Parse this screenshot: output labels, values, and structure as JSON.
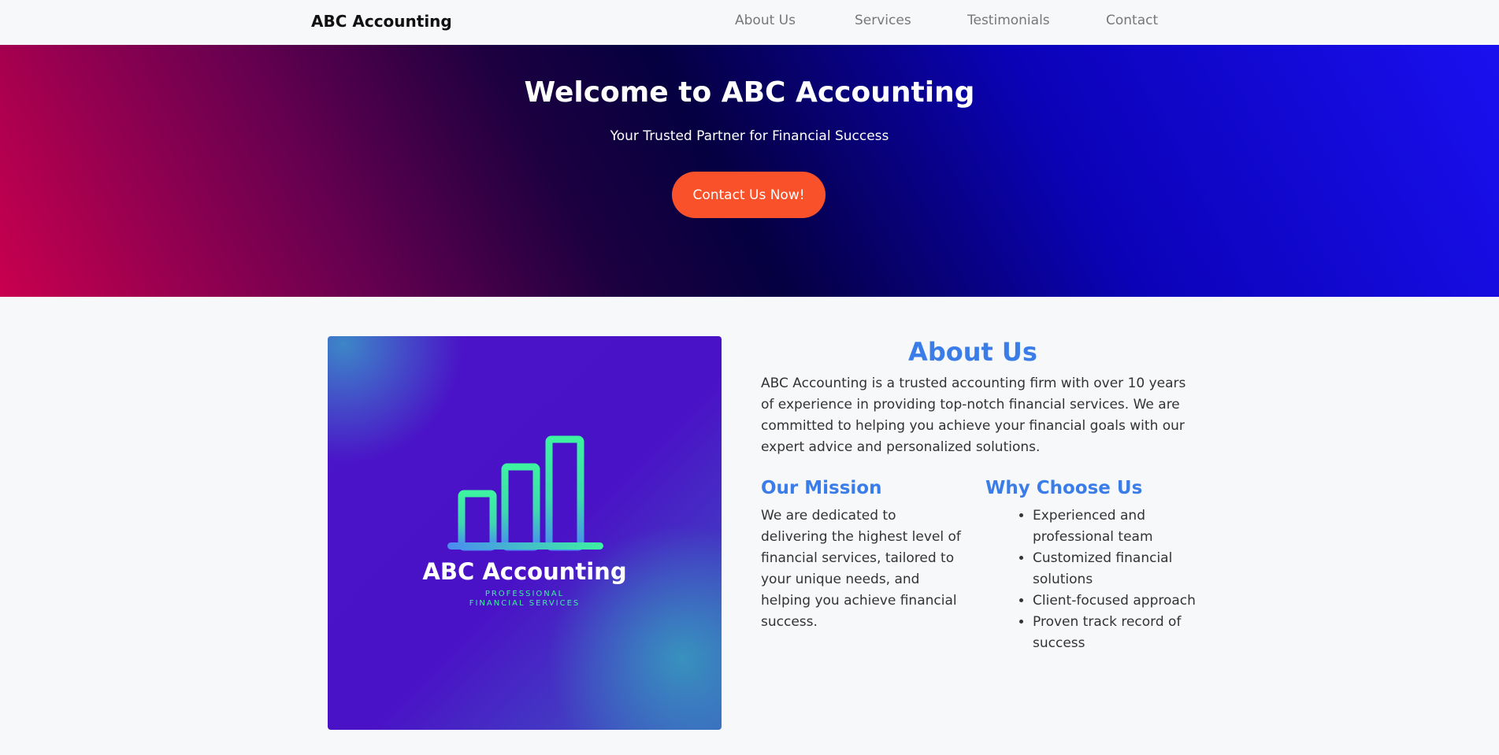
{
  "navbar": {
    "brand": "ABC Accounting",
    "links": [
      "About Us",
      "Services",
      "Testimonials",
      "Contact"
    ]
  },
  "hero": {
    "title": "Welcome to ABC Accounting",
    "subtitle": "Your Trusted Partner for Financial Success",
    "cta_label": "Contact Us Now!",
    "cta_color": "#f9522a"
  },
  "logo": {
    "icon": "bar-chart-icon",
    "name": "ABC Accounting",
    "tagline_line1": "PROFESSIONAL",
    "tagline_line2": "FINANCIAL SERVICES"
  },
  "about": {
    "title": "About Us",
    "text": "ABC Accounting is a trusted accounting firm with over 10 years of experience in providing top-notch financial services. We are committed to helping you achieve your financial goals with our expert advice and personalized solutions.",
    "mission": {
      "title": "Our Mission",
      "text": "We are dedicated to delivering the highest level of financial services, tailored to your unique needs, and helping you achieve financial success."
    },
    "why": {
      "title": "Why Choose Us",
      "items": [
        "Experienced and professional team",
        "Customized financial solutions",
        "Client-focused approach",
        "Proven track record of success"
      ]
    }
  },
  "colors": {
    "accent": "#3b7de8",
    "hero_start": "#c8004f",
    "hero_end": "#1a10f0",
    "logo_bars": "#3df2a0"
  }
}
